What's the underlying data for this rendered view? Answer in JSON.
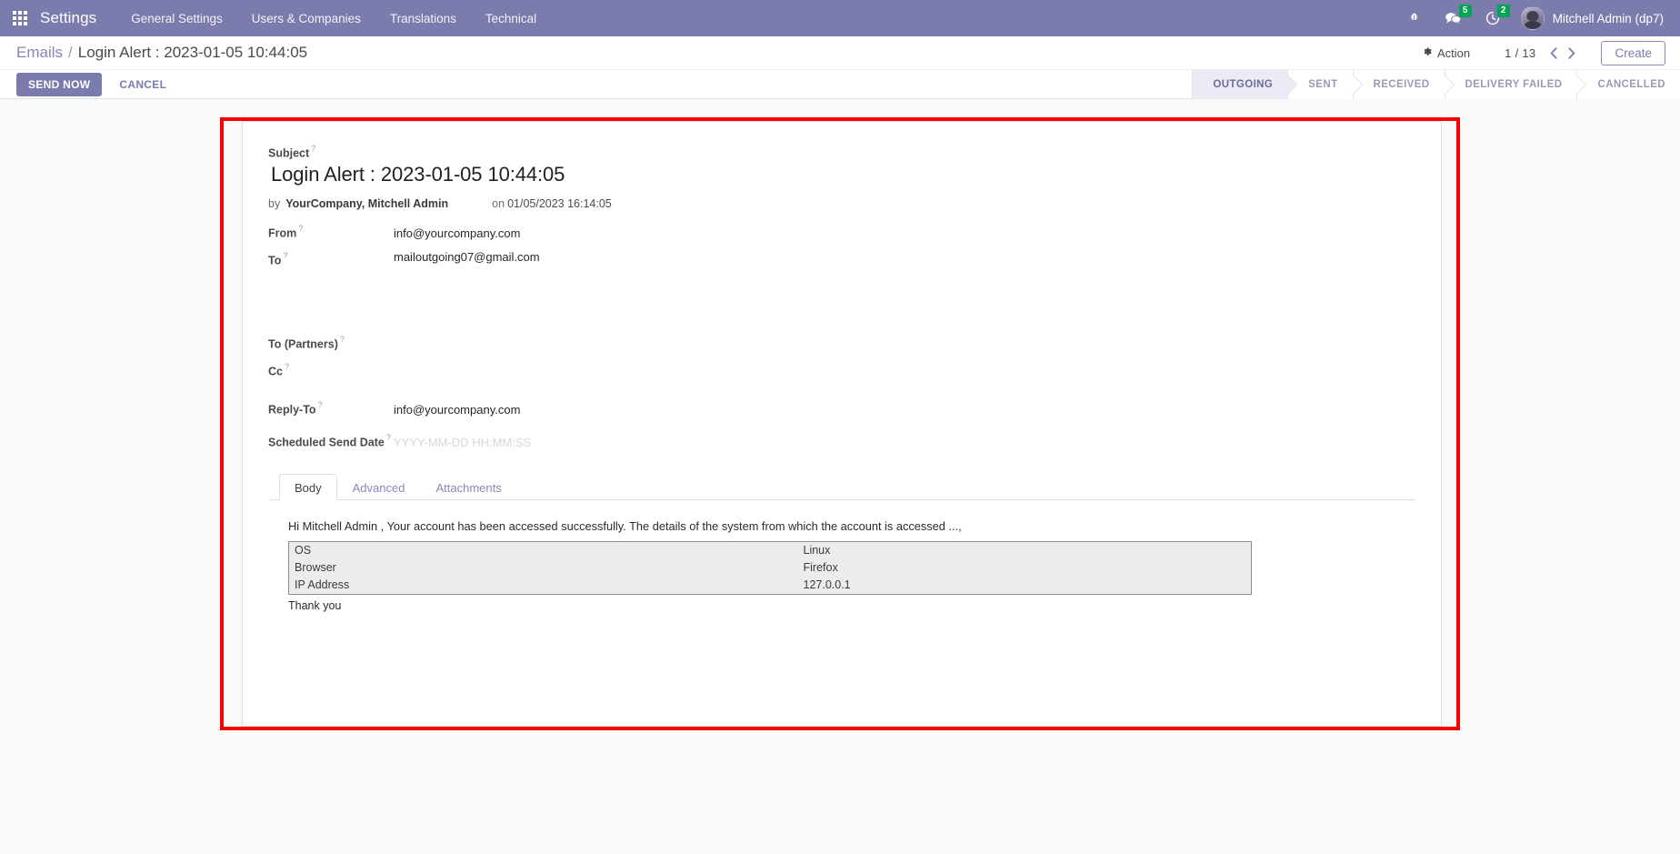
{
  "navbar": {
    "apps_icon": "apps-grid-icon",
    "brand": "Settings",
    "menu": [
      {
        "label": "General Settings"
      },
      {
        "label": "Users & Companies"
      },
      {
        "label": "Translations"
      },
      {
        "label": "Technical"
      }
    ],
    "sys_icons": [
      {
        "name": "bug-icon",
        "glyph": "☣",
        "badge": ""
      },
      {
        "name": "messages-icon",
        "glyph": "ὊC",
        "badge": "5"
      },
      {
        "name": "activities-clock-icon",
        "glyph": "◴",
        "badge": "2"
      }
    ],
    "messages_badge": "5",
    "activities_badge": "2",
    "user_name": "Mitchell Admin (dp7)"
  },
  "control_panel": {
    "breadcrumb_root": "Emails",
    "breadcrumb_separator": "/",
    "breadcrumb_current": "Login Alert : 2023-01-05 10:44:05",
    "action_label": "Action",
    "pager": "1 / 13",
    "prev_glyph": "‹",
    "next_glyph": "›",
    "create_label": "Create"
  },
  "buttons": {
    "send_now": "SEND NOW",
    "cancel": "CANCEL"
  },
  "statusbar": {
    "items": [
      {
        "label": "OUTGOING",
        "active": true
      },
      {
        "label": "SENT",
        "active": false
      },
      {
        "label": "RECEIVED",
        "active": false
      },
      {
        "label": "DELIVERY FAILED",
        "active": false
      },
      {
        "label": "CANCELLED",
        "active": false
      }
    ]
  },
  "form": {
    "subject_label": "Subject",
    "subject_value": "Login Alert : 2023-01-05 10:44:05",
    "by_word": "by",
    "author": "YourCompany, Mitchell Admin",
    "on_word": "on",
    "created_date": "01/05/2023 16:14:05",
    "fields": [
      {
        "label": "From",
        "value": "info@yourcompany.com",
        "placeholder": ""
      },
      {
        "label": "To",
        "value": "mailoutgoing07@gmail.com",
        "placeholder": ""
      },
      {
        "label": "To (Partners)",
        "value": "",
        "placeholder": ""
      },
      {
        "label": "Cc",
        "value": "",
        "placeholder": ""
      },
      {
        "label": "Reply-To",
        "value": "info@yourcompany.com",
        "placeholder": ""
      },
      {
        "label": "Scheduled Send Date",
        "value": "",
        "placeholder": "YYYY-MM-DD HH:MM:SS"
      }
    ],
    "help_mark": "?"
  },
  "notebook": {
    "tabs": [
      {
        "label": "Body",
        "active": true
      },
      {
        "label": "Advanced",
        "active": false
      },
      {
        "label": "Attachments",
        "active": false
      }
    ]
  },
  "mail_body": {
    "intro": "Hi Mitchell Admin , Your account has been accessed successfully. The details of the system from which the account is accessed ...,",
    "table": [
      {
        "key": "OS",
        "value": "Linux"
      },
      {
        "key": "Browser",
        "value": "Firefox"
      },
      {
        "key": "IP Address",
        "value": "127.0.0.1"
      }
    ],
    "signoff": "Thank you"
  },
  "colors": {
    "brand_purple": "#7c7bad",
    "badge_green": "#00a54f",
    "highlight_red": "#fb0000"
  }
}
